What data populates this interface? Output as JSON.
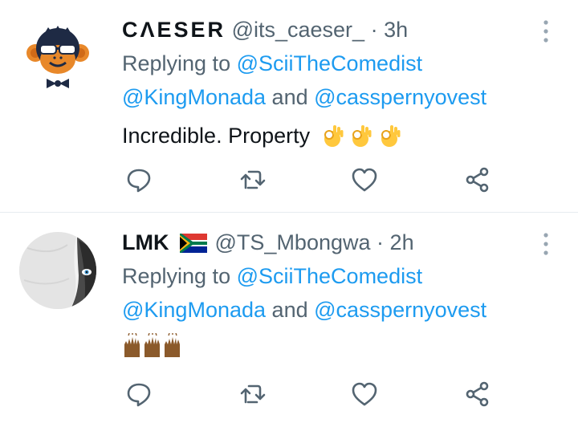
{
  "tweets": [
    {
      "display_name": "CΛESER",
      "handle": "@its_caeser_",
      "separator": "·",
      "time": "3h",
      "replying_prefix": "Replying to",
      "mention1": "@SciiTheComedist",
      "mention2": "@KingMonada",
      "and_text": "and",
      "mention3": "@casspernyovest",
      "text": "Incredible. Property",
      "emoji": "ok-hand-emoji x3",
      "avatar": "monkey-sunglasses-logo"
    },
    {
      "display_name": "LMK",
      "flag": "south-africa-flag",
      "handle": "@TS_Mbongwa",
      "separator": "·",
      "time": "2h",
      "replying_prefix": "Replying to",
      "mention1": "@SciiTheComedist",
      "mention2": "@KingMonada",
      "and_text": "and",
      "mention3": "@casspernyovest",
      "text": "",
      "emoji": "raising-hands-emoji x3",
      "avatar": "face-peeking-photo"
    }
  ],
  "actions": [
    "reply-icon",
    "retweet-icon",
    "like-icon",
    "share-icon"
  ],
  "colors": {
    "link": "#1d9bf0",
    "muted": "#536471",
    "text": "#0f1419",
    "divider": "#e6ecf0"
  }
}
